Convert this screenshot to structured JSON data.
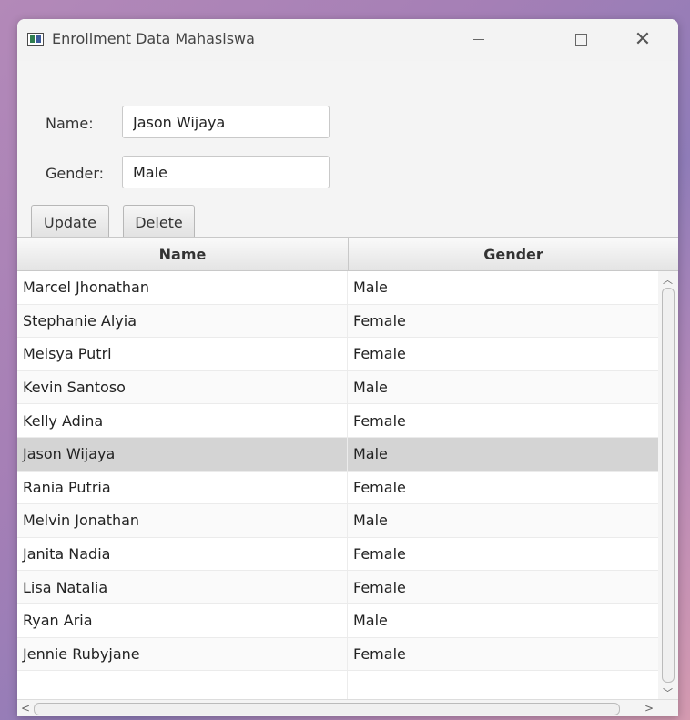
{
  "window": {
    "title": "Enrollment Data Mahasiswa",
    "controls": {
      "minimize": "—",
      "close": "✕"
    }
  },
  "form": {
    "name_label": "Name:",
    "name_value": "Jason Wijaya",
    "gender_label": "Gender:",
    "gender_value": "Male",
    "update_label": "Update",
    "delete_label": "Delete"
  },
  "table": {
    "columns": [
      "Name",
      "Gender"
    ],
    "rows": [
      {
        "name": "Marcel Jhonathan",
        "gender": "Male"
      },
      {
        "name": "Stephanie Alyia",
        "gender": "Female"
      },
      {
        "name": "Meisya Putri",
        "gender": "Female"
      },
      {
        "name": "Kevin Santoso",
        "gender": "Male"
      },
      {
        "name": "Kelly Adina",
        "gender": "Female"
      },
      {
        "name": "Jason Wijaya",
        "gender": "Male"
      },
      {
        "name": "Rania Putria",
        "gender": "Female"
      },
      {
        "name": "Melvin Jonathan",
        "gender": "Male"
      },
      {
        "name": "Janita Nadia",
        "gender": "Female"
      },
      {
        "name": "Lisa Natalia",
        "gender": "Female"
      },
      {
        "name": "Ryan Aria",
        "gender": "Male"
      },
      {
        "name": "Jennie Rubyjane",
        "gender": "Female"
      },
      {
        "name": "",
        "gender": ""
      }
    ],
    "selected_index": 5
  },
  "icons": {
    "app": "app-window-icon",
    "scroll_up": "chevron-up-icon",
    "scroll_down": "chevron-down-icon",
    "scroll_left": "chevron-left-icon",
    "scroll_right": "chevron-right-icon"
  }
}
